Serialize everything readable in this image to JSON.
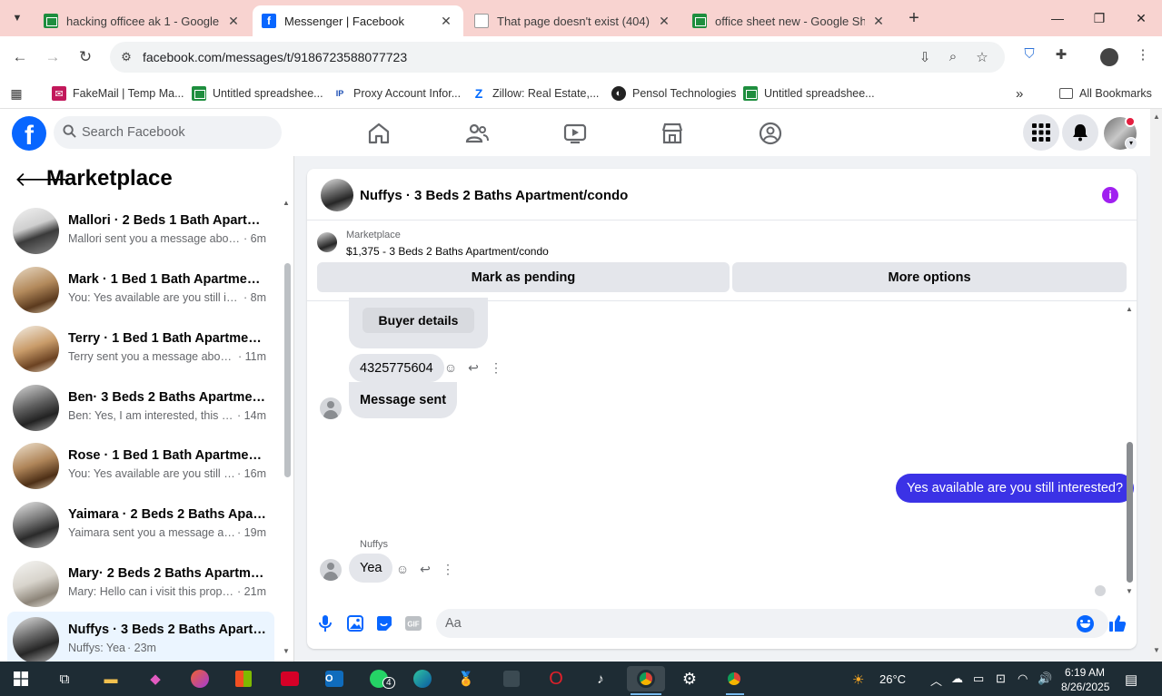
{
  "browser": {
    "tabs": [
      {
        "title": "hacking officee ak 1 - Google D",
        "favicon": "google-sheets-icon"
      },
      {
        "title": "Messenger | Facebook",
        "favicon": "facebook-icon"
      },
      {
        "title": "That page doesn't exist (404) - I",
        "favicon": "globe-icon"
      },
      {
        "title": "office sheet new - Google Shee",
        "favicon": "google-sheets-icon"
      }
    ],
    "url": "facebook.com/messages/t/9186723588077723",
    "bookmarks": [
      {
        "label": "FakeMail | Temp Ma...",
        "icon": "fakemail-icon"
      },
      {
        "label": "Untitled spreadshee...",
        "icon": "google-sheets-icon"
      },
      {
        "label": "Proxy Account Infor...",
        "icon": "proxy-icon"
      },
      {
        "label": "Zillow: Real Estate,...",
        "icon": "zillow-icon"
      },
      {
        "label": "Pensol Technologies",
        "icon": "pensol-icon"
      },
      {
        "label": "Untitled spreadshee...",
        "icon": "google-sheets-icon"
      }
    ],
    "all_bookmarks": "All Bookmarks",
    "more_bookmarks": "»"
  },
  "facebook": {
    "logo": "f",
    "search_placeholder": "Search Facebook"
  },
  "left_panel": {
    "title": "Marketplace",
    "conversations": [
      {
        "name": "Mallori · 2 Beds 1 Bath Apartment/condo",
        "preview": "Mallori sent you a message about ...",
        "time": "· 6m",
        "active": false
      },
      {
        "name": "Mark · 1 Bed 1 Bath Apartment/condo",
        "preview": "You: Yes available are you still inter...",
        "time": "· 8m",
        "active": false
      },
      {
        "name": "Terry · 1 Bed 1 Bath Apartment/condo",
        "preview": "Terry sent you a message about y...",
        "time": "· 11m",
        "active": false
      },
      {
        "name": "Ben· 3 Beds 2 Baths Apartment/condo",
        "preview": "Ben: Yes, I am interested, this is ...",
        "time": "· 14m",
        "active": false
      },
      {
        "name": "Rose · 1 Bed 1 Bath Apartment/condo",
        "preview": "You: Yes available are you still int...",
        "time": "· 16m",
        "active": false
      },
      {
        "name": "Yaimara · 2 Beds 2 Baths Apartment/condo",
        "preview": "Yaimara sent you a message abo...",
        "time": "· 19m",
        "active": false
      },
      {
        "name": "Mary· 2 Beds 2 Baths Apartment/condo",
        "preview": "Mary: Hello can i visit this proper...",
        "time": "· 21m",
        "active": false
      },
      {
        "name": "Nuffys · 3 Beds 2 Baths Apartment/condo",
        "preview": "Nuffys: Yea",
        "time": "· 23m",
        "active": true
      }
    ]
  },
  "chat": {
    "title": "Nuffys · 3 Beds 2 Baths Apartment/condo",
    "listing_label": "Marketplace",
    "listing_title": "$1,375 - 3 Beds 2 Baths Apartment/condo",
    "mark_pending": "Mark as pending",
    "more_options": "More options",
    "buyer_details": "Buyer details",
    "phone_message": "4325775604",
    "message_sent": "Message sent",
    "outgoing_message": "Yes available are you still  interested?",
    "sender_name": "Nuffys",
    "reply_message": "Yea",
    "composer_placeholder": "Aa"
  },
  "taskbar": {
    "badge_count": "4",
    "temperature": "26°C",
    "time": "6:19 AM",
    "date": "8/26/2025"
  },
  "colors": {
    "facebook_blue": "#0866ff",
    "outgoing_bubble": "#3b32e6",
    "tab_strip": "#f8d3d0"
  }
}
